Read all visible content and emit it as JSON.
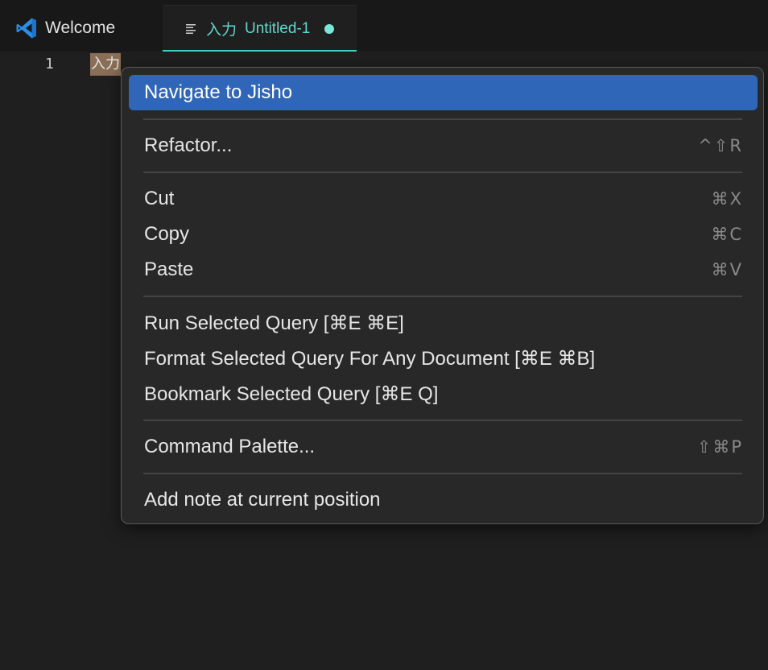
{
  "tabs": {
    "welcome": {
      "label": "Welcome",
      "icon": "vscode-logo-icon"
    },
    "untitled": {
      "icon": "document-lines-icon",
      "prefix": "入力",
      "label": "Untitled-1",
      "dirty_indicator": "unsaved-dot-icon",
      "accent_color": "#5fd9cc"
    }
  },
  "editor": {
    "line_number": "1",
    "line_text": "入力",
    "selection_color": "#8a6e56"
  },
  "context_menu": {
    "selected_color": "#2f66b7",
    "items": [
      {
        "label": "Navigate to Jisho",
        "shortcut": ""
      },
      {
        "label": "Refactor...",
        "shortcut": "^⇧R"
      },
      {
        "label": "Cut",
        "shortcut": "⌘X"
      },
      {
        "label": "Copy",
        "shortcut": "⌘C"
      },
      {
        "label": "Paste",
        "shortcut": "⌘V"
      },
      {
        "label": "Run Selected Query [⌘E ⌘E]",
        "shortcut": ""
      },
      {
        "label": "Format Selected Query For Any Document [⌘E ⌘B]",
        "shortcut": ""
      },
      {
        "label": "Bookmark Selected Query [⌘E Q]",
        "shortcut": ""
      },
      {
        "label": "Command Palette...",
        "shortcut": "⇧⌘P"
      },
      {
        "label": "Add note at current position",
        "shortcut": ""
      }
    ]
  }
}
